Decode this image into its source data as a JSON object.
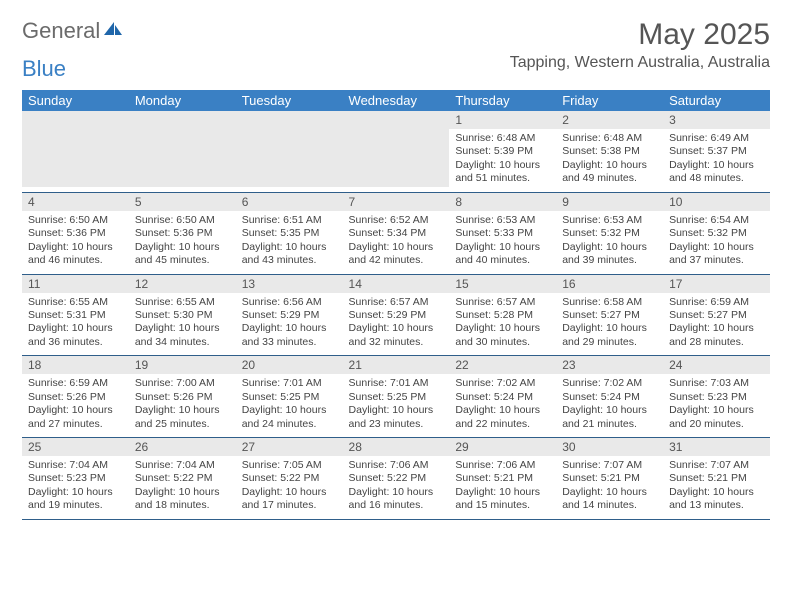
{
  "brand": {
    "part1": "General",
    "part2": "Blue"
  },
  "title": "May 2025",
  "location": "Tapping, Western Australia, Australia",
  "weekdays": [
    "Sunday",
    "Monday",
    "Tuesday",
    "Wednesday",
    "Thursday",
    "Friday",
    "Saturday"
  ],
  "weeks": [
    [
      {
        "n": "",
        "sr": "",
        "ss": "",
        "dl": ""
      },
      {
        "n": "",
        "sr": "",
        "ss": "",
        "dl": ""
      },
      {
        "n": "",
        "sr": "",
        "ss": "",
        "dl": ""
      },
      {
        "n": "",
        "sr": "",
        "ss": "",
        "dl": ""
      },
      {
        "n": "1",
        "sr": "Sunrise: 6:48 AM",
        "ss": "Sunset: 5:39 PM",
        "dl": "Daylight: 10 hours and 51 minutes."
      },
      {
        "n": "2",
        "sr": "Sunrise: 6:48 AM",
        "ss": "Sunset: 5:38 PM",
        "dl": "Daylight: 10 hours and 49 minutes."
      },
      {
        "n": "3",
        "sr": "Sunrise: 6:49 AM",
        "ss": "Sunset: 5:37 PM",
        "dl": "Daylight: 10 hours and 48 minutes."
      }
    ],
    [
      {
        "n": "4",
        "sr": "Sunrise: 6:50 AM",
        "ss": "Sunset: 5:36 PM",
        "dl": "Daylight: 10 hours and 46 minutes."
      },
      {
        "n": "5",
        "sr": "Sunrise: 6:50 AM",
        "ss": "Sunset: 5:36 PM",
        "dl": "Daylight: 10 hours and 45 minutes."
      },
      {
        "n": "6",
        "sr": "Sunrise: 6:51 AM",
        "ss": "Sunset: 5:35 PM",
        "dl": "Daylight: 10 hours and 43 minutes."
      },
      {
        "n": "7",
        "sr": "Sunrise: 6:52 AM",
        "ss": "Sunset: 5:34 PM",
        "dl": "Daylight: 10 hours and 42 minutes."
      },
      {
        "n": "8",
        "sr": "Sunrise: 6:53 AM",
        "ss": "Sunset: 5:33 PM",
        "dl": "Daylight: 10 hours and 40 minutes."
      },
      {
        "n": "9",
        "sr": "Sunrise: 6:53 AM",
        "ss": "Sunset: 5:32 PM",
        "dl": "Daylight: 10 hours and 39 minutes."
      },
      {
        "n": "10",
        "sr": "Sunrise: 6:54 AM",
        "ss": "Sunset: 5:32 PM",
        "dl": "Daylight: 10 hours and 37 minutes."
      }
    ],
    [
      {
        "n": "11",
        "sr": "Sunrise: 6:55 AM",
        "ss": "Sunset: 5:31 PM",
        "dl": "Daylight: 10 hours and 36 minutes."
      },
      {
        "n": "12",
        "sr": "Sunrise: 6:55 AM",
        "ss": "Sunset: 5:30 PM",
        "dl": "Daylight: 10 hours and 34 minutes."
      },
      {
        "n": "13",
        "sr": "Sunrise: 6:56 AM",
        "ss": "Sunset: 5:29 PM",
        "dl": "Daylight: 10 hours and 33 minutes."
      },
      {
        "n": "14",
        "sr": "Sunrise: 6:57 AM",
        "ss": "Sunset: 5:29 PM",
        "dl": "Daylight: 10 hours and 32 minutes."
      },
      {
        "n": "15",
        "sr": "Sunrise: 6:57 AM",
        "ss": "Sunset: 5:28 PM",
        "dl": "Daylight: 10 hours and 30 minutes."
      },
      {
        "n": "16",
        "sr": "Sunrise: 6:58 AM",
        "ss": "Sunset: 5:27 PM",
        "dl": "Daylight: 10 hours and 29 minutes."
      },
      {
        "n": "17",
        "sr": "Sunrise: 6:59 AM",
        "ss": "Sunset: 5:27 PM",
        "dl": "Daylight: 10 hours and 28 minutes."
      }
    ],
    [
      {
        "n": "18",
        "sr": "Sunrise: 6:59 AM",
        "ss": "Sunset: 5:26 PM",
        "dl": "Daylight: 10 hours and 27 minutes."
      },
      {
        "n": "19",
        "sr": "Sunrise: 7:00 AM",
        "ss": "Sunset: 5:26 PM",
        "dl": "Daylight: 10 hours and 25 minutes."
      },
      {
        "n": "20",
        "sr": "Sunrise: 7:01 AM",
        "ss": "Sunset: 5:25 PM",
        "dl": "Daylight: 10 hours and 24 minutes."
      },
      {
        "n": "21",
        "sr": "Sunrise: 7:01 AM",
        "ss": "Sunset: 5:25 PM",
        "dl": "Daylight: 10 hours and 23 minutes."
      },
      {
        "n": "22",
        "sr": "Sunrise: 7:02 AM",
        "ss": "Sunset: 5:24 PM",
        "dl": "Daylight: 10 hours and 22 minutes."
      },
      {
        "n": "23",
        "sr": "Sunrise: 7:02 AM",
        "ss": "Sunset: 5:24 PM",
        "dl": "Daylight: 10 hours and 21 minutes."
      },
      {
        "n": "24",
        "sr": "Sunrise: 7:03 AM",
        "ss": "Sunset: 5:23 PM",
        "dl": "Daylight: 10 hours and 20 minutes."
      }
    ],
    [
      {
        "n": "25",
        "sr": "Sunrise: 7:04 AM",
        "ss": "Sunset: 5:23 PM",
        "dl": "Daylight: 10 hours and 19 minutes."
      },
      {
        "n": "26",
        "sr": "Sunrise: 7:04 AM",
        "ss": "Sunset: 5:22 PM",
        "dl": "Daylight: 10 hours and 18 minutes."
      },
      {
        "n": "27",
        "sr": "Sunrise: 7:05 AM",
        "ss": "Sunset: 5:22 PM",
        "dl": "Daylight: 10 hours and 17 minutes."
      },
      {
        "n": "28",
        "sr": "Sunrise: 7:06 AM",
        "ss": "Sunset: 5:22 PM",
        "dl": "Daylight: 10 hours and 16 minutes."
      },
      {
        "n": "29",
        "sr": "Sunrise: 7:06 AM",
        "ss": "Sunset: 5:21 PM",
        "dl": "Daylight: 10 hours and 15 minutes."
      },
      {
        "n": "30",
        "sr": "Sunrise: 7:07 AM",
        "ss": "Sunset: 5:21 PM",
        "dl": "Daylight: 10 hours and 14 minutes."
      },
      {
        "n": "31",
        "sr": "Sunrise: 7:07 AM",
        "ss": "Sunset: 5:21 PM",
        "dl": "Daylight: 10 hours and 13 minutes."
      }
    ]
  ]
}
